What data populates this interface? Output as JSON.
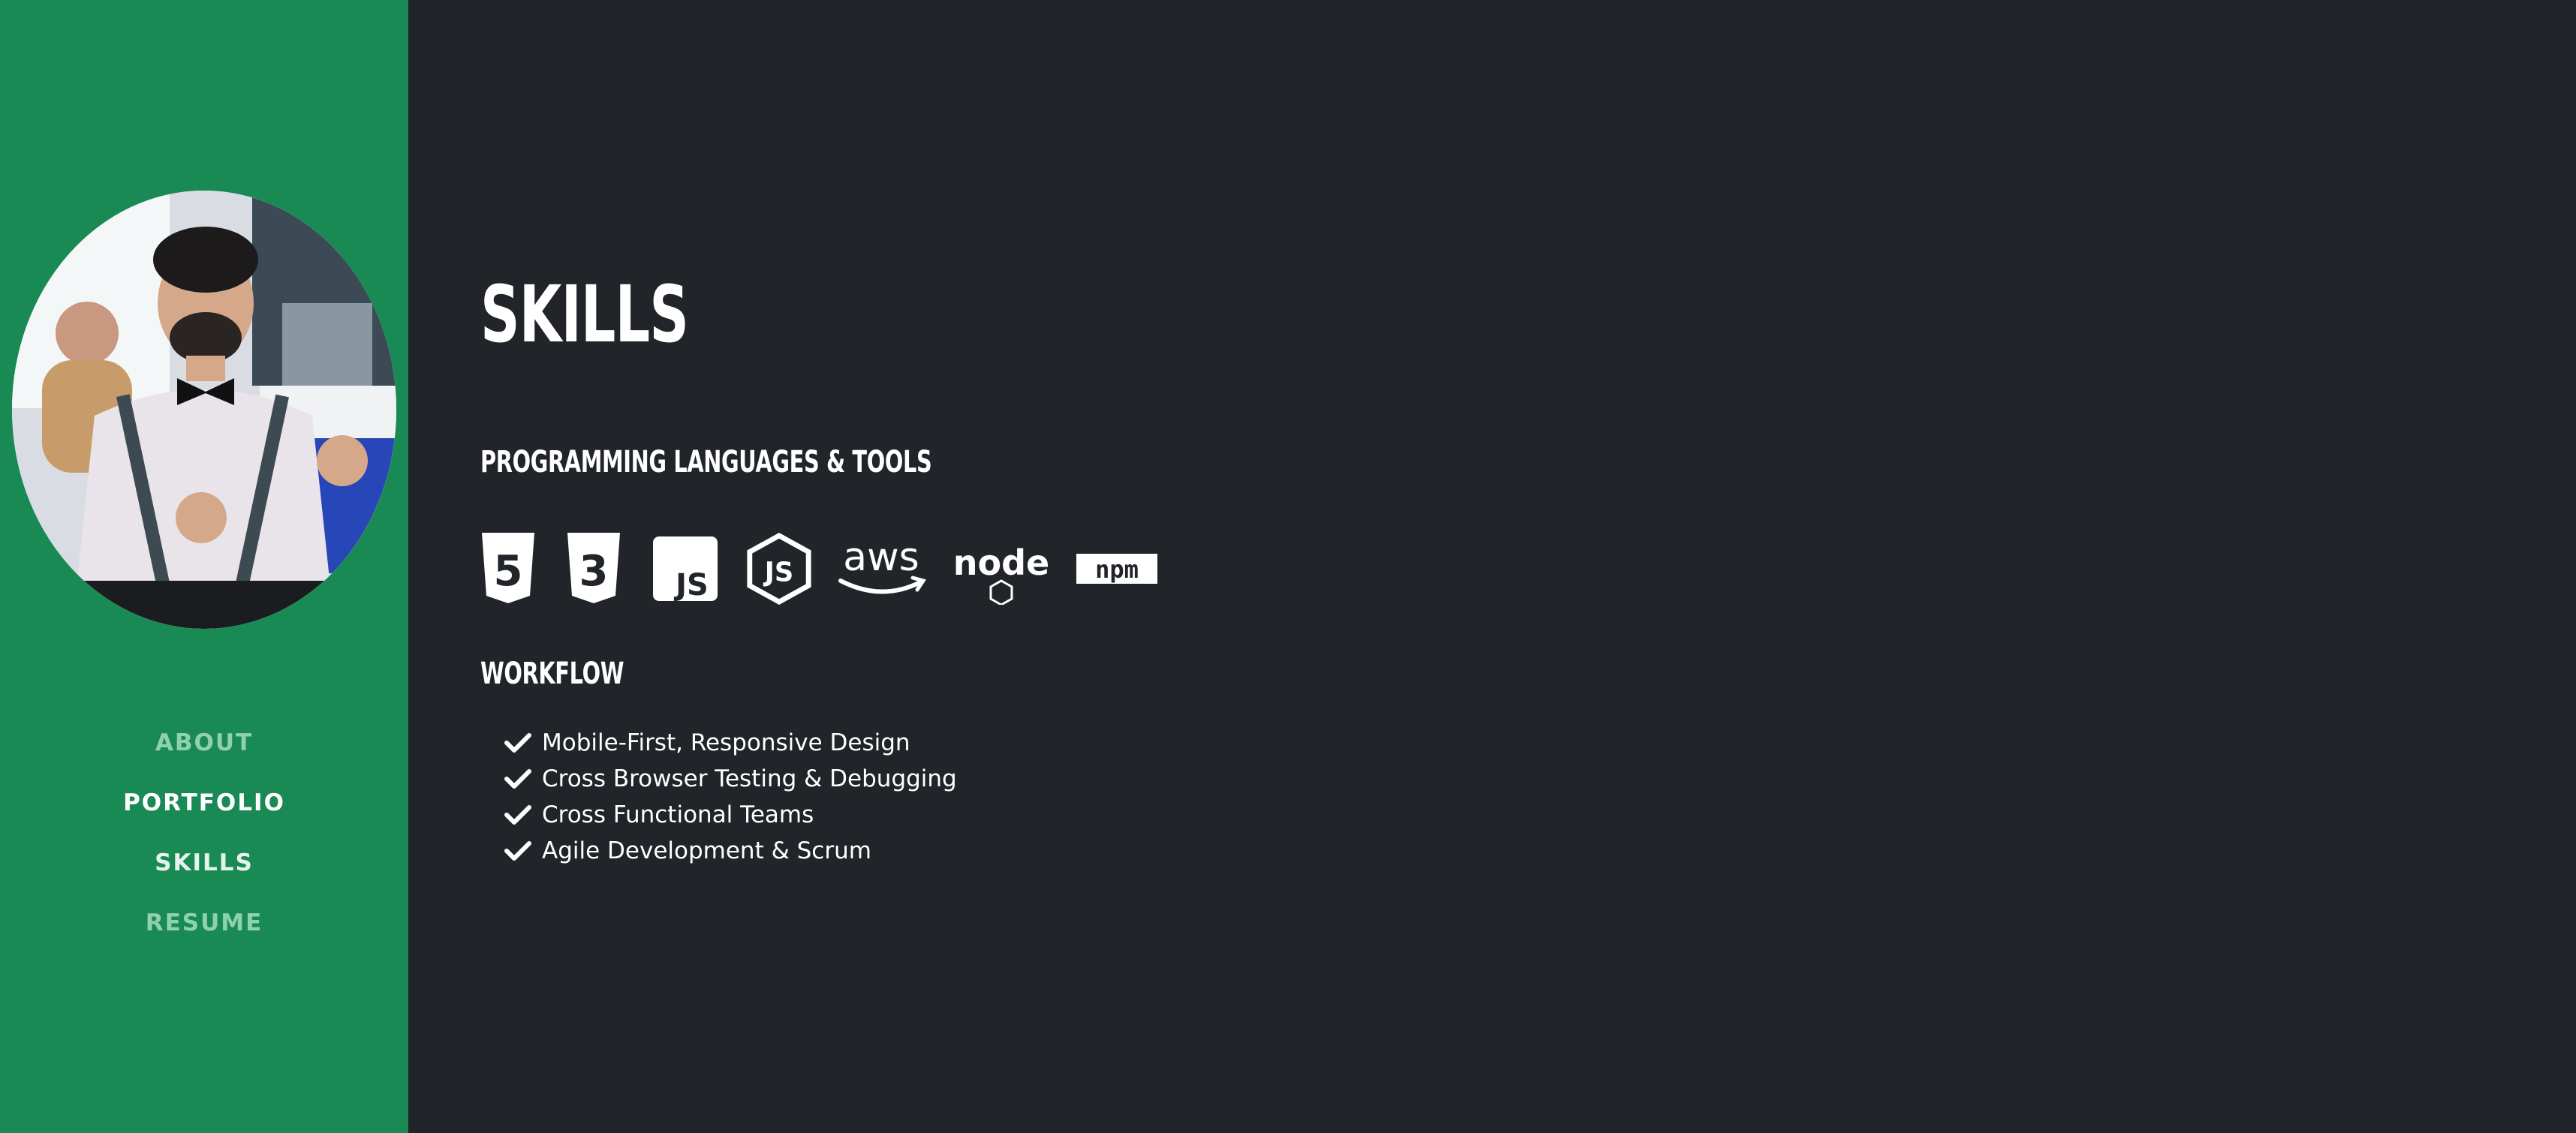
{
  "sidebar": {
    "avatar_alt": "profile photo",
    "nav": [
      {
        "label": "ABOUT"
      },
      {
        "label": "PORTFOLIO"
      },
      {
        "label": "SKILLS"
      },
      {
        "label": "RESUME"
      }
    ]
  },
  "main": {
    "title": "SKILLS",
    "tools_heading": "PROGRAMMING LANGUAGES & TOOLS",
    "tools": [
      {
        "icon": "html5-icon",
        "label": "5"
      },
      {
        "icon": "css3-icon",
        "label": "3"
      },
      {
        "icon": "javascript-icon",
        "label": "JS"
      },
      {
        "icon": "nodejs-hex-icon",
        "label": "JS"
      },
      {
        "icon": "aws-icon",
        "label": "aws"
      },
      {
        "icon": "node-logo-icon",
        "label": "node"
      },
      {
        "icon": "npm-icon",
        "label": "npm"
      }
    ],
    "workflow_heading": "WORKFLOW",
    "workflow": [
      "Mobile-First, Responsive Design",
      "Cross Browser Testing & Debugging",
      "Cross Functional Teams",
      "Agile Development & Scrum"
    ]
  },
  "colors": {
    "sidebar": "#1a8a55",
    "background": "#212429",
    "text": "#ffffff",
    "nav_dim": "#8fd0ad"
  }
}
